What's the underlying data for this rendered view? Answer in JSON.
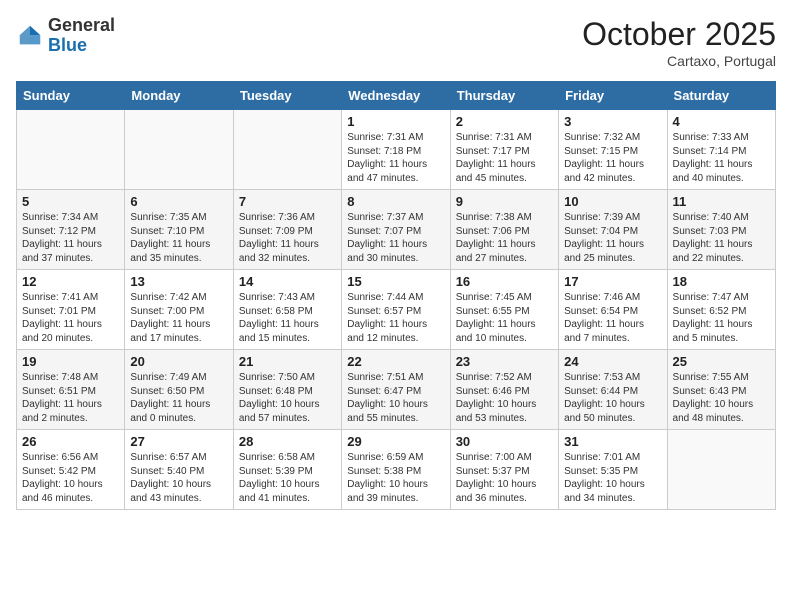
{
  "header": {
    "logo_general": "General",
    "logo_blue": "Blue",
    "month_title": "October 2025",
    "location": "Cartaxo, Portugal"
  },
  "weekdays": [
    "Sunday",
    "Monday",
    "Tuesday",
    "Wednesday",
    "Thursday",
    "Friday",
    "Saturday"
  ],
  "rows": [
    [
      {
        "day": "",
        "content": ""
      },
      {
        "day": "",
        "content": ""
      },
      {
        "day": "",
        "content": ""
      },
      {
        "day": "1",
        "content": "Sunrise: 7:31 AM\nSunset: 7:18 PM\nDaylight: 11 hours\nand 47 minutes."
      },
      {
        "day": "2",
        "content": "Sunrise: 7:31 AM\nSunset: 7:17 PM\nDaylight: 11 hours\nand 45 minutes."
      },
      {
        "day": "3",
        "content": "Sunrise: 7:32 AM\nSunset: 7:15 PM\nDaylight: 11 hours\nand 42 minutes."
      },
      {
        "day": "4",
        "content": "Sunrise: 7:33 AM\nSunset: 7:14 PM\nDaylight: 11 hours\nand 40 minutes."
      }
    ],
    [
      {
        "day": "5",
        "content": "Sunrise: 7:34 AM\nSunset: 7:12 PM\nDaylight: 11 hours\nand 37 minutes."
      },
      {
        "day": "6",
        "content": "Sunrise: 7:35 AM\nSunset: 7:10 PM\nDaylight: 11 hours\nand 35 minutes."
      },
      {
        "day": "7",
        "content": "Sunrise: 7:36 AM\nSunset: 7:09 PM\nDaylight: 11 hours\nand 32 minutes."
      },
      {
        "day": "8",
        "content": "Sunrise: 7:37 AM\nSunset: 7:07 PM\nDaylight: 11 hours\nand 30 minutes."
      },
      {
        "day": "9",
        "content": "Sunrise: 7:38 AM\nSunset: 7:06 PM\nDaylight: 11 hours\nand 27 minutes."
      },
      {
        "day": "10",
        "content": "Sunrise: 7:39 AM\nSunset: 7:04 PM\nDaylight: 11 hours\nand 25 minutes."
      },
      {
        "day": "11",
        "content": "Sunrise: 7:40 AM\nSunset: 7:03 PM\nDaylight: 11 hours\nand 22 minutes."
      }
    ],
    [
      {
        "day": "12",
        "content": "Sunrise: 7:41 AM\nSunset: 7:01 PM\nDaylight: 11 hours\nand 20 minutes."
      },
      {
        "day": "13",
        "content": "Sunrise: 7:42 AM\nSunset: 7:00 PM\nDaylight: 11 hours\nand 17 minutes."
      },
      {
        "day": "14",
        "content": "Sunrise: 7:43 AM\nSunset: 6:58 PM\nDaylight: 11 hours\nand 15 minutes."
      },
      {
        "day": "15",
        "content": "Sunrise: 7:44 AM\nSunset: 6:57 PM\nDaylight: 11 hours\nand 12 minutes."
      },
      {
        "day": "16",
        "content": "Sunrise: 7:45 AM\nSunset: 6:55 PM\nDaylight: 11 hours\nand 10 minutes."
      },
      {
        "day": "17",
        "content": "Sunrise: 7:46 AM\nSunset: 6:54 PM\nDaylight: 11 hours\nand 7 minutes."
      },
      {
        "day": "18",
        "content": "Sunrise: 7:47 AM\nSunset: 6:52 PM\nDaylight: 11 hours\nand 5 minutes."
      }
    ],
    [
      {
        "day": "19",
        "content": "Sunrise: 7:48 AM\nSunset: 6:51 PM\nDaylight: 11 hours\nand 2 minutes."
      },
      {
        "day": "20",
        "content": "Sunrise: 7:49 AM\nSunset: 6:50 PM\nDaylight: 11 hours\nand 0 minutes."
      },
      {
        "day": "21",
        "content": "Sunrise: 7:50 AM\nSunset: 6:48 PM\nDaylight: 10 hours\nand 57 minutes."
      },
      {
        "day": "22",
        "content": "Sunrise: 7:51 AM\nSunset: 6:47 PM\nDaylight: 10 hours\nand 55 minutes."
      },
      {
        "day": "23",
        "content": "Sunrise: 7:52 AM\nSunset: 6:46 PM\nDaylight: 10 hours\nand 53 minutes."
      },
      {
        "day": "24",
        "content": "Sunrise: 7:53 AM\nSunset: 6:44 PM\nDaylight: 10 hours\nand 50 minutes."
      },
      {
        "day": "25",
        "content": "Sunrise: 7:55 AM\nSunset: 6:43 PM\nDaylight: 10 hours\nand 48 minutes."
      }
    ],
    [
      {
        "day": "26",
        "content": "Sunrise: 6:56 AM\nSunset: 5:42 PM\nDaylight: 10 hours\nand 46 minutes."
      },
      {
        "day": "27",
        "content": "Sunrise: 6:57 AM\nSunset: 5:40 PM\nDaylight: 10 hours\nand 43 minutes."
      },
      {
        "day": "28",
        "content": "Sunrise: 6:58 AM\nSunset: 5:39 PM\nDaylight: 10 hours\nand 41 minutes."
      },
      {
        "day": "29",
        "content": "Sunrise: 6:59 AM\nSunset: 5:38 PM\nDaylight: 10 hours\nand 39 minutes."
      },
      {
        "day": "30",
        "content": "Sunrise: 7:00 AM\nSunset: 5:37 PM\nDaylight: 10 hours\nand 36 minutes."
      },
      {
        "day": "31",
        "content": "Sunrise: 7:01 AM\nSunset: 5:35 PM\nDaylight: 10 hours\nand 34 minutes."
      },
      {
        "day": "",
        "content": ""
      }
    ]
  ]
}
